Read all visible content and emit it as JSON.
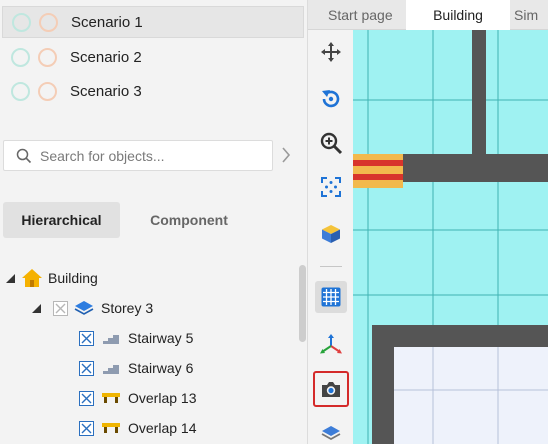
{
  "scenarios": [
    {
      "label": "Scenario 1",
      "selected": true
    },
    {
      "label": "Scenario 2",
      "selected": false
    },
    {
      "label": "Scenario 3",
      "selected": false
    }
  ],
  "search": {
    "placeholder": "Search for objects..."
  },
  "view_tabs": {
    "hierarchical": "Hierarchical",
    "component": "Component",
    "active": "hierarchical"
  },
  "tree": {
    "root": {
      "label": "Building",
      "icon": "house-icon",
      "expanded": true
    },
    "storey": {
      "label": "Storey 3",
      "icon": "layers-icon",
      "checked": false,
      "expanded": true
    },
    "items": [
      {
        "label": "Stairway 5",
        "icon": "stairway-icon",
        "checked": true
      },
      {
        "label": "Stairway 6",
        "icon": "stairway-icon",
        "checked": true
      },
      {
        "label": "Overlap 13",
        "icon": "overlap-icon",
        "checked": true
      },
      {
        "label": "Overlap 14",
        "icon": "overlap-icon",
        "checked": true
      }
    ]
  },
  "doc_tabs": [
    {
      "label": "Start page",
      "active": false
    },
    {
      "label": "Building",
      "active": true
    },
    {
      "label": "Sim",
      "active": false
    }
  ],
  "tools": [
    "move-icon",
    "rotate-icon",
    "zoom-icon",
    "fit-view-icon",
    "cube-icon",
    "grid-icon",
    "axes-icon",
    "camera-icon",
    "layers-icon"
  ],
  "colors": {
    "accent": "#2a6fbf",
    "highlight": "#d42a2a",
    "canvas_bg": "#9ff2f2",
    "wall": "#555555"
  }
}
